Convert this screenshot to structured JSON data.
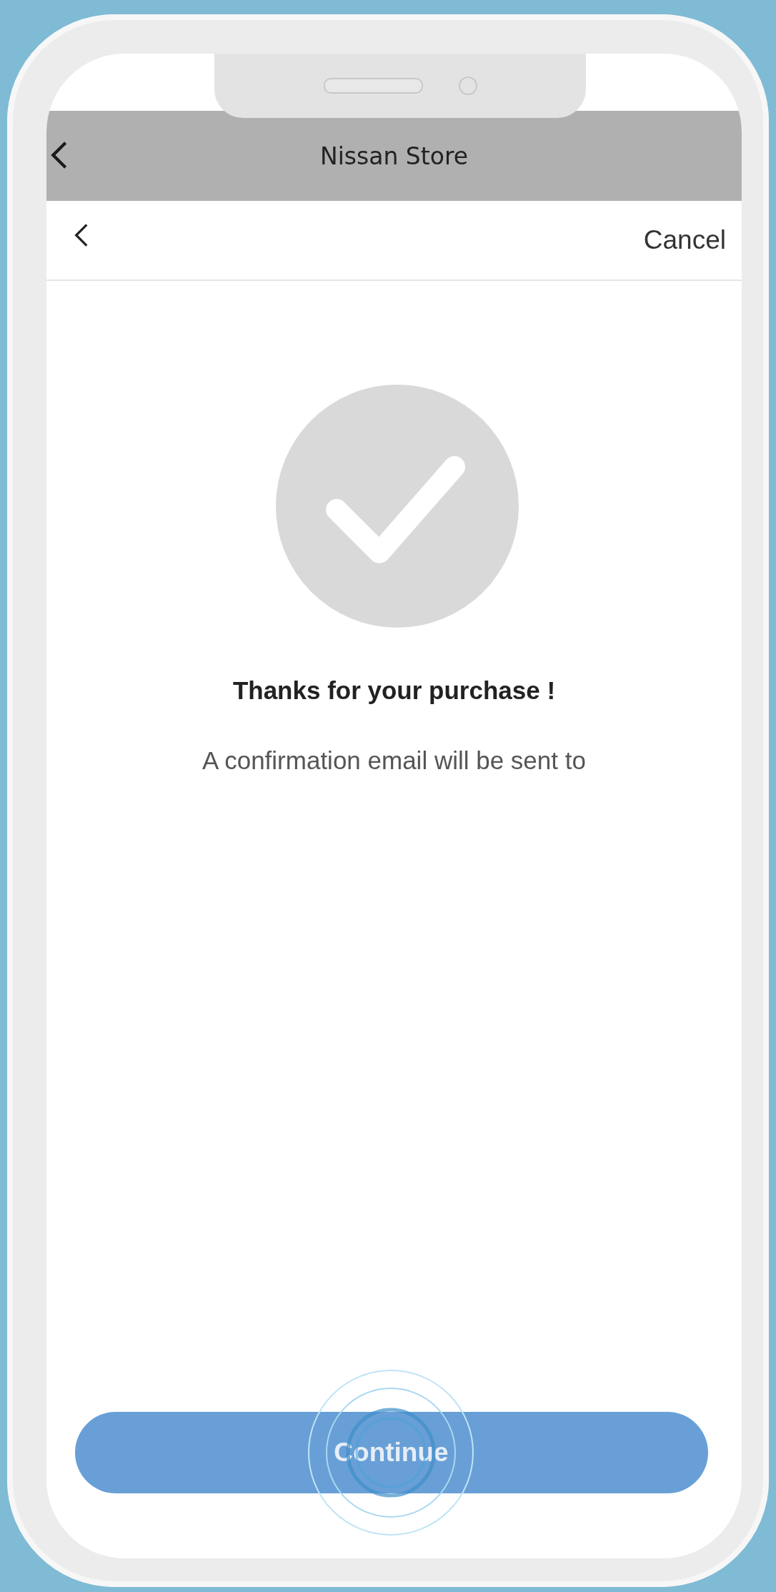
{
  "app_bar": {
    "title": "Nissan Store"
  },
  "nav_bar": {
    "action": "Cancel"
  },
  "confirmation": {
    "title": "Thanks for your purchase !",
    "message": "A confirmation email will be sent to"
  },
  "button": {
    "label": "Continue",
    "pressed": true
  }
}
